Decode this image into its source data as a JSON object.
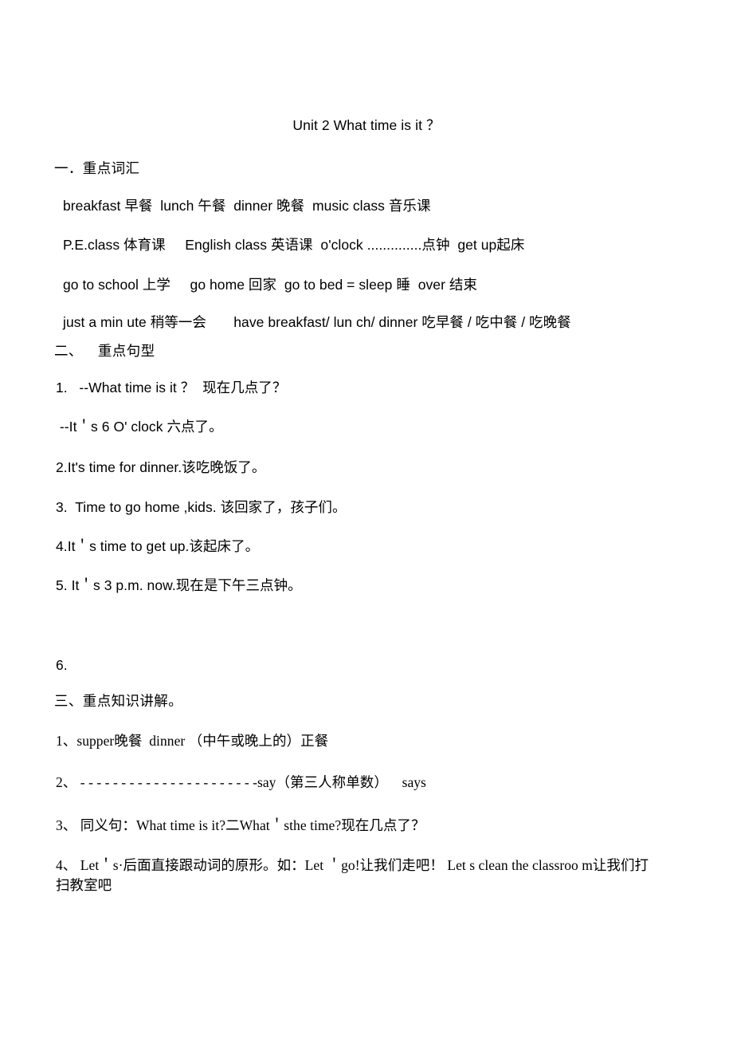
{
  "document": {
    "title": "Unit 2 What time is it ？",
    "background_color": "#ffffff",
    "text_color": "#000000"
  },
  "sections": {
    "vocabulary": {
      "heading": "一．重点词汇",
      "lines": [
        "breakfast 早餐  lunch 午餐  dinner 晚餐  music class 音乐课",
        "P.E.class 体育课     English class 英语课  o'clock ..............点钟  get up起床",
        "go to school 上学     go home 回家  go to bed = sleep 睡  over 结束",
        "just a min ute 稍等一会       have breakfast/ lun ch/ dinner 吃早餐 / 吃中餐 / 吃晚餐"
      ]
    },
    "sentence_patterns": {
      "heading": "二、    重点句型",
      "items": [
        "1.   --What time is it ？  现在几点了？",
        " --It＇s 6 O' clock 六点了。",
        "2.It's time for dinner.该吃晚饭了。",
        "3.  Time to go home ,kids. 该回家了，孩子们。",
        "4.It＇s time to get up.该起床了。",
        "5. It＇s 3 p.m. now.现在是下午三点钟。",
        "6."
      ]
    },
    "key_points": {
      "heading": "三、重点知识讲解。",
      "items": [
        "1、supper晚餐  dinner （中午或晚上的）正餐",
        "2、 - - - - - - - - - - - - - - - - - - - - - -say（第三人称单数）    says",
        "3、 同义句：What time is it?二What＇sthe time?现在几点了？",
        "4、 Let＇s·后面直接跟动词的原形。如：Let ＇go!让我们走吧！ Let s clean the classroo m让我们打扫教室吧"
      ]
    }
  }
}
